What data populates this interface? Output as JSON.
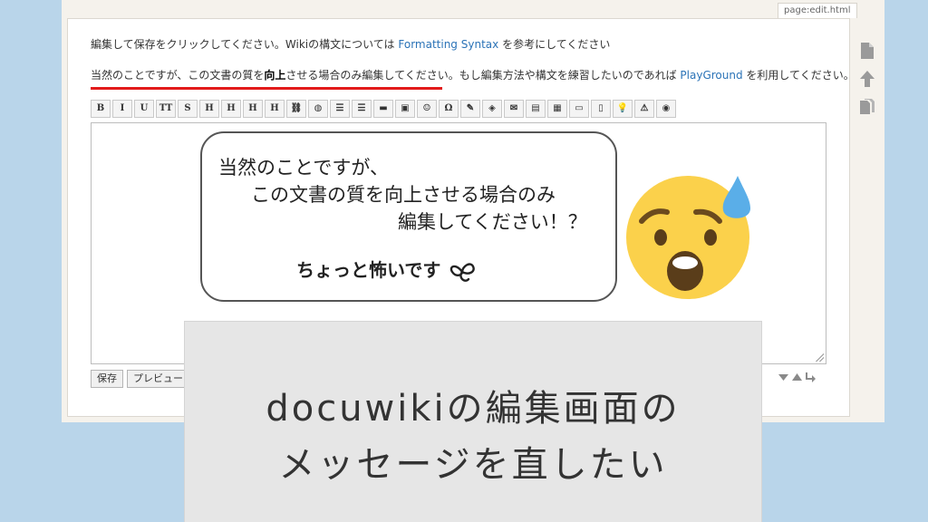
{
  "page": {
    "pagename": "page:edit.html",
    "intro_line1": {
      "part1": "編集して保存をクリックしてください。Wikiの構文については",
      "link": "Formatting Syntax",
      "part2": "を参考にしてください"
    },
    "intro_line2": {
      "part1": "当然のことですが、この文書の質を",
      "bold": "向上",
      "part2": "させる場合のみ編集してください。もし編集方法や構文を練習したいのであれば",
      "link": "PlayGround",
      "part3": "を利用してください。"
    }
  },
  "toolbar": {
    "buttons": [
      {
        "name": "bold-button",
        "label": "B"
      },
      {
        "name": "italic-button",
        "label": "I"
      },
      {
        "name": "underline-button",
        "label": "U"
      },
      {
        "name": "monospace-button",
        "label": "TT"
      },
      {
        "name": "strikethrough-button",
        "label": "S"
      },
      {
        "name": "heading-same-button",
        "label": "H"
      },
      {
        "name": "heading-lower-button",
        "label": "H"
      },
      {
        "name": "heading-higher-button",
        "label": "H"
      },
      {
        "name": "heading-select-button",
        "label": "H"
      },
      {
        "name": "internal-link-button",
        "label": "⛓"
      },
      {
        "name": "external-link-button",
        "label": "◍"
      },
      {
        "name": "ordered-list-button",
        "label": "☰"
      },
      {
        "name": "unordered-list-button",
        "label": "☰"
      },
      {
        "name": "horizontal-rule-button",
        "label": "▬"
      },
      {
        "name": "media-button",
        "label": "▣"
      },
      {
        "name": "smiley-button",
        "label": "☺"
      },
      {
        "name": "special-chars-button",
        "label": "Ω"
      },
      {
        "name": "signature-button",
        "label": "✎"
      },
      {
        "name": "plugin-button",
        "label": "◈"
      },
      {
        "name": "mail-button",
        "label": "✉"
      },
      {
        "name": "note-button",
        "label": "▤"
      },
      {
        "name": "table-button",
        "label": "▦"
      },
      {
        "name": "folder-button",
        "label": "▭"
      },
      {
        "name": "page-button",
        "label": "▯"
      },
      {
        "name": "tip-button",
        "label": "💡"
      },
      {
        "name": "warning-button",
        "label": "⚠"
      },
      {
        "name": "stop-button",
        "label": "◉"
      }
    ]
  },
  "buttons": {
    "save": "保存",
    "preview": "プレビュー"
  },
  "bubble": {
    "line1": "当然のことですが、",
    "line2": "この文書の質を向上させる場合のみ",
    "line3": "編集してください！？",
    "scary": "ちょっと怖いです"
  },
  "card": {
    "line1": "docuwikiの編集画面の",
    "line2": "メッセージを直したい"
  },
  "colors": {
    "background": "#b9d5ea",
    "link": "#2b73b7",
    "underline": "#e21b1b",
    "emoji_face": "#fbd14b",
    "sweat_drop": "#5aaee8"
  }
}
